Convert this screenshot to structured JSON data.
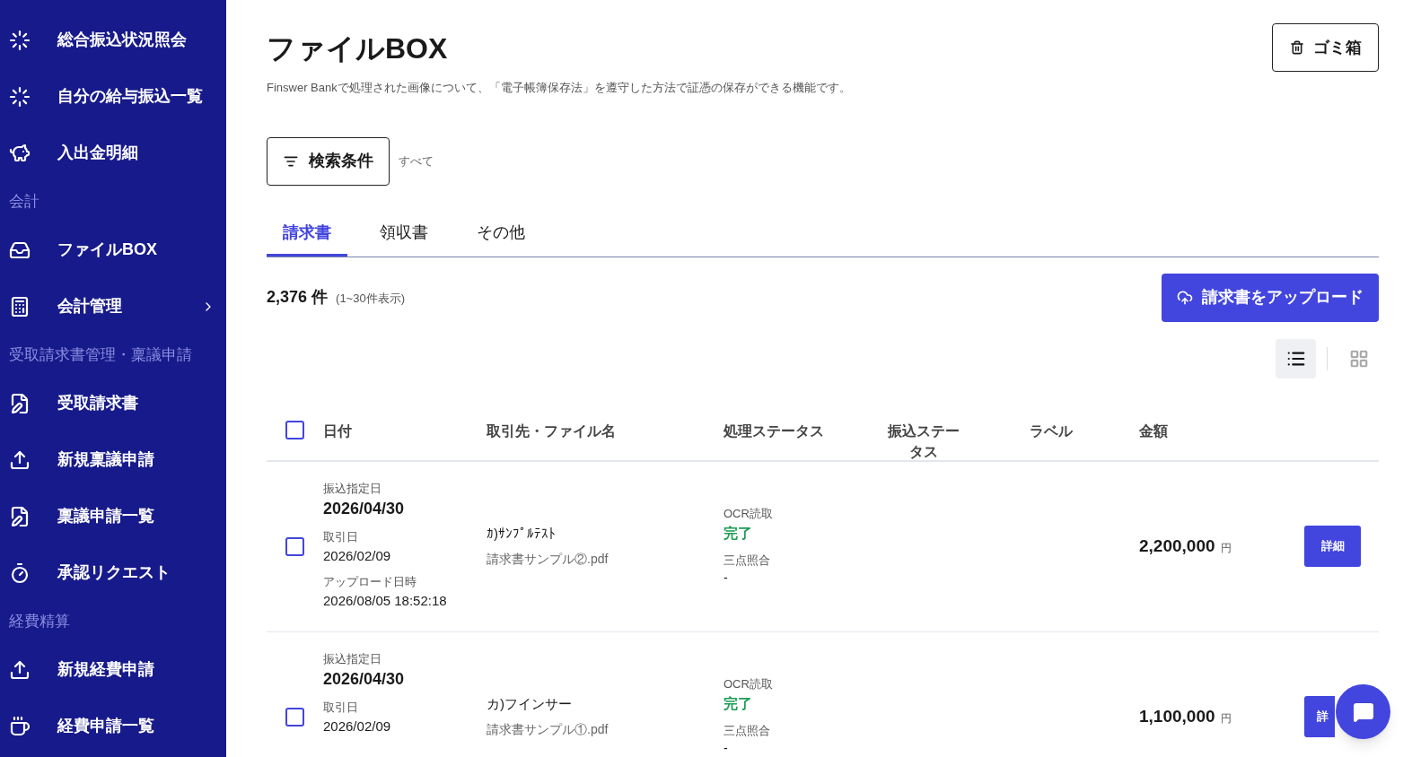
{
  "sidebar": [
    {
      "kind": "item",
      "label": "総合振込状況照会",
      "submenu": false
    },
    {
      "kind": "item",
      "label": "自分の給与振込一覧",
      "submenu": false
    },
    {
      "kind": "item",
      "label": "入出金明細",
      "submenu": false
    },
    {
      "kind": "section",
      "label": "会計"
    },
    {
      "kind": "item",
      "label": "ファイルBOX",
      "submenu": false
    },
    {
      "kind": "item",
      "label": "会計管理",
      "submenu": true
    },
    {
      "kind": "section",
      "label": "受取請求書管理・稟議申請"
    },
    {
      "kind": "item",
      "label": "受取請求書",
      "submenu": false
    },
    {
      "kind": "item",
      "label": "新規稟議申請",
      "submenu": false
    },
    {
      "kind": "item",
      "label": "稟議申請一覧",
      "submenu": false
    },
    {
      "kind": "item",
      "label": "承認リクエスト",
      "submenu": false
    },
    {
      "kind": "section",
      "label": "経費精算"
    },
    {
      "kind": "item",
      "label": "新規経費申請",
      "submenu": false
    },
    {
      "kind": "item",
      "label": "経費申請一覧",
      "submenu": false
    }
  ],
  "page": {
    "title": "ファイルBOX",
    "description": "Finswer Bankで処理された画像について、「電子帳簿保存法」を遵守した方法で証憑の保存ができる機能です。",
    "trash_button": "ゴミ箱"
  },
  "filter": {
    "button": "検索条件",
    "value": "すべて"
  },
  "tabs": [
    {
      "label": "請求書",
      "selected": true
    },
    {
      "label": "領収書",
      "selected": false
    },
    {
      "label": "その他",
      "selected": false
    }
  ],
  "summary": {
    "count": "2,376 件",
    "range": "(1~30件表示)"
  },
  "upload_button": "請求書をアップロード",
  "view_modes": [
    {
      "kind": "list",
      "selected": true
    },
    {
      "kind": "grid",
      "selected": false
    }
  ],
  "table": {
    "select_all_checked": false,
    "columns": [
      "日付",
      "取引先・ファイル名",
      "処理ステータス",
      "振込ステータス",
      "ラベル",
      "金額"
    ],
    "rows": [
      {
        "checked": false,
        "dates": [
          {
            "label": "振込指定日",
            "value": "2026/04/30"
          },
          {
            "label": "取引日",
            "value": "2026/02/09"
          },
          {
            "label": "アップロード日時",
            "value": "2026/08/05 18:52:18"
          }
        ],
        "vendor": "ｶ)ｻﾝﾌﾟﾙﾃｽﾄ",
        "file": "請求書サンプル②.pdf",
        "ocr_label": "OCR読取",
        "ocr_status": "完了",
        "match_label": "三点照合",
        "match_value": "-",
        "amount": "2,200,000",
        "currency": "円",
        "detail_button": "詳細",
        "detail_button_partial": false
      },
      {
        "checked": false,
        "dates": [
          {
            "label": "振込指定日",
            "value": "2026/04/30"
          },
          {
            "label": "取引日",
            "value": "2026/02/09"
          }
        ],
        "vendor": "カ)フインサー",
        "file": "請求書サンプル①.pdf",
        "ocr_label": "OCR読取",
        "ocr_status": "完了",
        "match_label": "三点照合",
        "match_value": "-",
        "amount": "1,100,000",
        "currency": "円",
        "detail_button": "詳",
        "detail_button_partial": true
      }
    ]
  }
}
